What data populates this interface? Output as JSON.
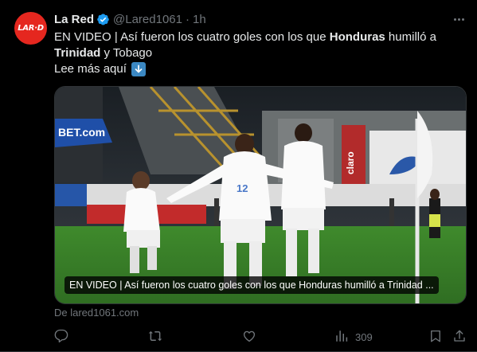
{
  "author": {
    "name": "La Red",
    "handle": "@Lared1061",
    "separator": "·",
    "time": "1h",
    "avatar_text": "LAR·D",
    "avatar_color": "#e5271f"
  },
  "post": {
    "line1_prefix": "EN VIDEO | Así fueron los cuatro goles con los que ",
    "line1_bold": "Honduras",
    "line1_suffix": " humilló a",
    "line2_bold": "Trinidad",
    "line2_suffix": " y Tobago",
    "line3": "Lee más aquí"
  },
  "card": {
    "caption": "EN VIDEO | Así fueron los cuatro goles con los que Honduras humilló a Trinidad ...",
    "source": "De lared1061.com",
    "player_number": "12",
    "banner_text": "BET.com",
    "ad_text": "claro"
  },
  "actions": {
    "views_count": "309"
  },
  "colors": {
    "background": "#000000",
    "text": "#e7e9ea",
    "muted": "#71767b",
    "verified": "#1d9bf0",
    "border": "#2f3336"
  }
}
